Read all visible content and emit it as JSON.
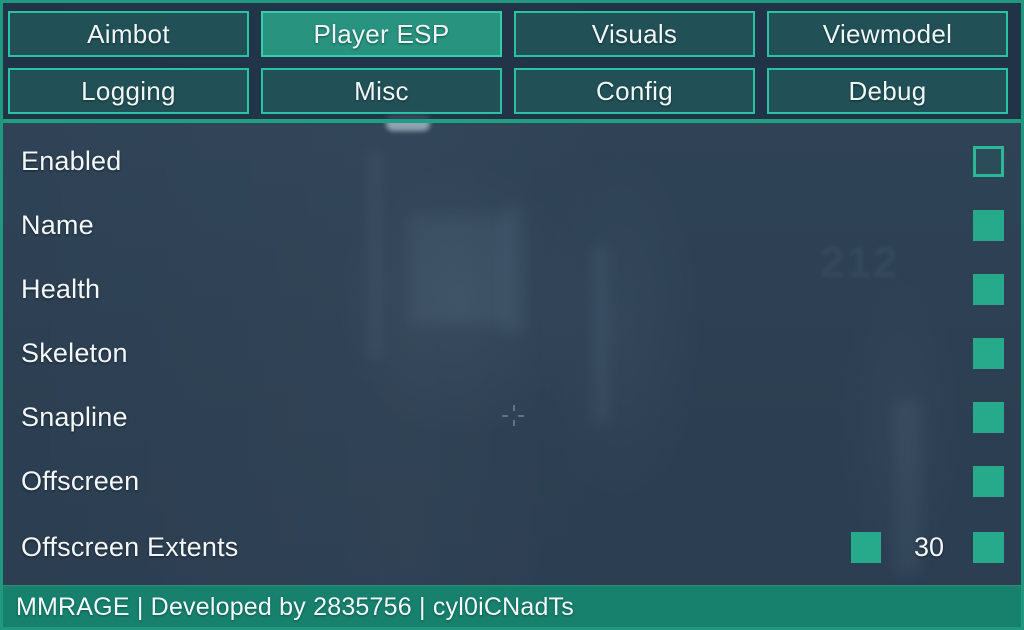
{
  "window": {
    "title": "MMRAGE",
    "accent_color": "#27a98c",
    "accent_bright_color": "#34cdab",
    "border_color": "#1f9a80",
    "panel_background_color": "#2e4154",
    "tabbar_background_color": "#1e3044",
    "status_background_color": "#17816e",
    "text_color": "#f2f8fa"
  },
  "tabs": {
    "active": "Player ESP",
    "rows": [
      [
        {
          "label": "Aimbot",
          "active": false
        },
        {
          "label": "Player ESP",
          "active": true
        },
        {
          "label": "Visuals",
          "active": false
        },
        {
          "label": "Viewmodel",
          "active": false
        }
      ],
      [
        {
          "label": "Logging",
          "active": false
        },
        {
          "label": "Misc",
          "active": false
        },
        {
          "label": "Config",
          "active": false
        },
        {
          "label": "Debug",
          "active": false
        }
      ]
    ]
  },
  "options": [
    {
      "label": "Enabled",
      "type": "checkbox",
      "checked": false
    },
    {
      "label": "Name",
      "type": "checkbox",
      "checked": true
    },
    {
      "label": "Health",
      "type": "checkbox",
      "checked": true
    },
    {
      "label": "Skeleton",
      "type": "checkbox",
      "checked": true
    },
    {
      "label": "Snapline",
      "type": "checkbox",
      "checked": true
    },
    {
      "label": "Offscreen",
      "type": "checkbox",
      "checked": true
    },
    {
      "label": "Offscreen Extents",
      "type": "slider-checkbox",
      "checked": true,
      "value": "30"
    }
  ],
  "statusbar": {
    "text": "MMRAGE | Developed by 2835756 | cyl0iCNadTs"
  }
}
